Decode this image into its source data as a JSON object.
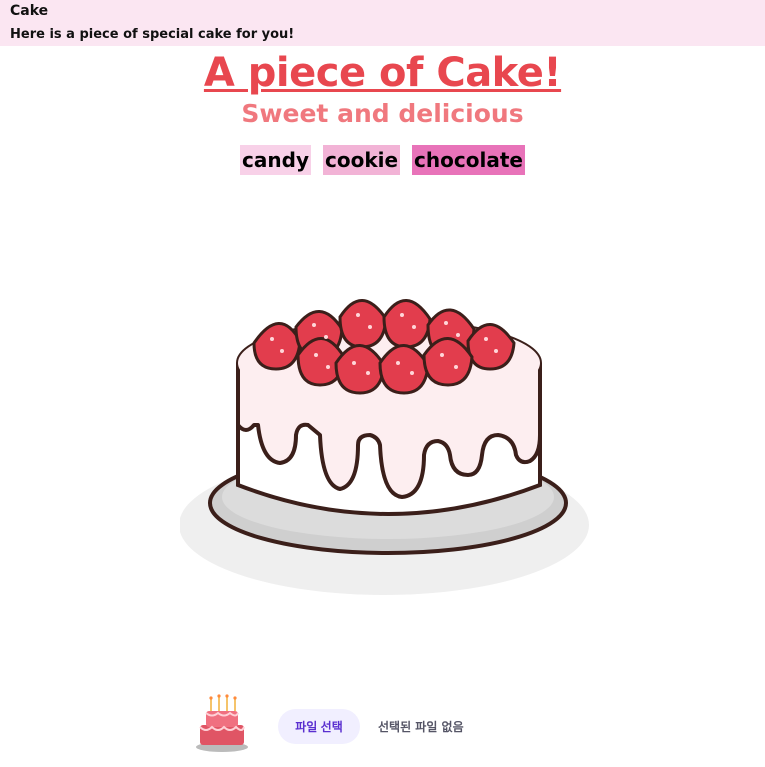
{
  "header": {
    "title": "Cake",
    "subtitle": "Here is a piece of special cake for you!"
  },
  "main": {
    "title": "A piece of Cake!",
    "subtitle": "Sweet and delicious",
    "tags": [
      "candy",
      "cookie",
      "chocolate"
    ]
  },
  "file_input": {
    "button_label": "파일 선택",
    "status": "선택된 파일 없음"
  },
  "colors": {
    "header_bg": "#fbe6f2",
    "title": "#e8474f",
    "subtitle": "#f0787e",
    "tag_candy": "#f8d1e8",
    "tag_cookie": "#f2b3d6",
    "tag_chocolate": "#e873b9",
    "strawberry": "#e23d4d",
    "cake_cream": "#fdeef0"
  },
  "icons": {
    "hero": "strawberry-cake-illustration",
    "thumbnail": "birthday-cake-thumbnail"
  }
}
